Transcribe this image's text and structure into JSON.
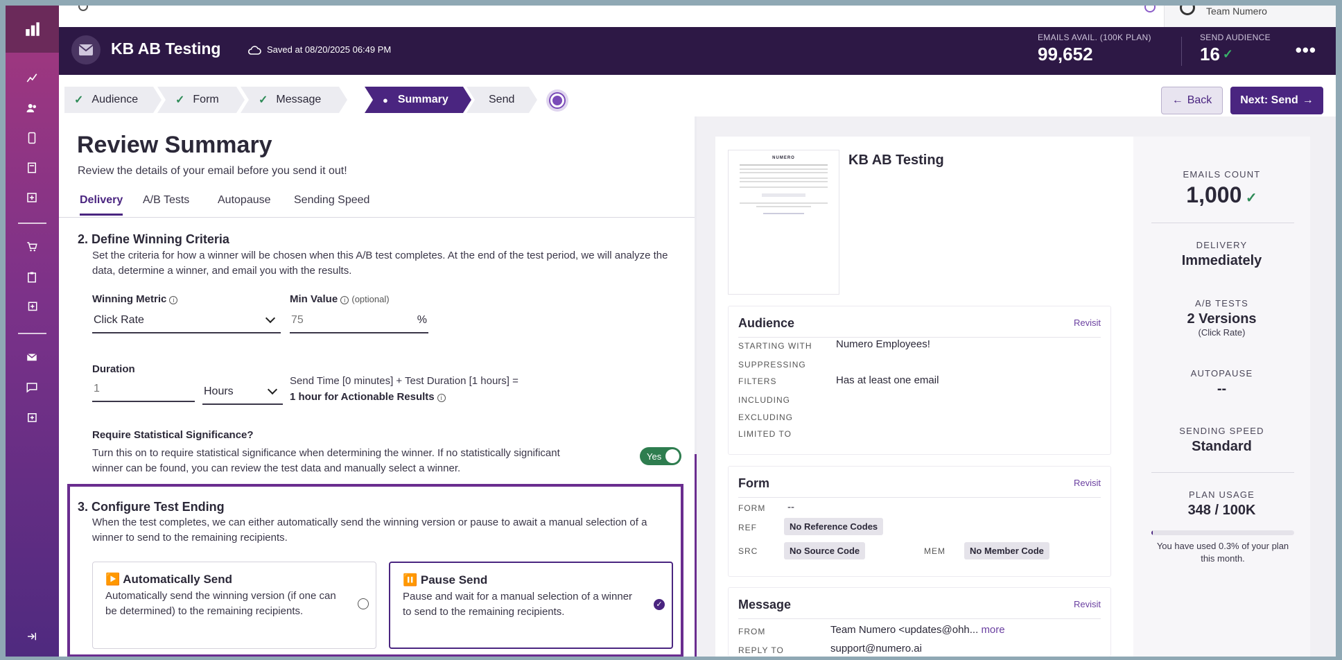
{
  "topbar": {
    "team_name": "Team Numero"
  },
  "header": {
    "title": "KB AB Testing",
    "saved_text": "Saved at 08/20/2025 06:49 PM",
    "emails_avail_label": "EMAILS AVAIL. (100K PLAN)",
    "emails_avail_value": "99,652",
    "send_audience_label": "SEND AUDIENCE",
    "send_audience_value": "16",
    "more_label": "•••"
  },
  "steps": [
    {
      "label": "Audience",
      "done": true
    },
    {
      "label": "Form",
      "done": true
    },
    {
      "label": "Message",
      "done": true
    },
    {
      "label": "Summary",
      "active": true
    },
    {
      "label": "Send"
    }
  ],
  "nav": {
    "back_label": "Back",
    "next_label": "Next: Send"
  },
  "review": {
    "title": "Review Summary",
    "subtitle": "Review the details of your email before you send it out!",
    "tabs": [
      "Delivery",
      "A/B Tests",
      "Autopause",
      "Sending Speed"
    ],
    "criteria": {
      "heading": "2. Define Winning Criteria",
      "description": "Set the criteria for how a winner will be chosen when this A/B test completes. At the end of the test period, we will analyze the data, determine a winner, and email you with the results.",
      "metric_label": "Winning Metric",
      "metric_value": "Click Rate",
      "min_label": "Min Value",
      "min_optional": "(optional)",
      "min_value": "75",
      "min_unit": "%",
      "duration_label": "Duration",
      "duration_value": "1",
      "duration_unit": "Hours",
      "calc_line1": "Send Time [0 minutes] + Test Duration [1 hours] =",
      "calc_line2": "1 hour for Actionable Results",
      "sig_label": "Require Statistical Significance?",
      "sig_description": "Turn this on to require statistical significance when determining the winner. If no statistically significant winner can be found, you can review the test data and manually select a winner.",
      "sig_toggle": "Yes"
    },
    "ending": {
      "heading": "3. Configure Test Ending",
      "description": "When the test completes, we can either automatically send the winning version or pause to await a manual selection of a winner to send to the remaining recipients.",
      "auto_title": "▶️ Automatically Send",
      "auto_desc": "Automatically send the winning version (if one can be determined) to the remaining recipients.",
      "pause_title": "⏸️ Pause Send",
      "pause_desc": "Pause and wait for a manual selection of a winner to send to the remaining recipients.",
      "selected": "pause"
    }
  },
  "preview": {
    "title": "KB AB Testing",
    "audience": {
      "heading": "Audience",
      "revisit": "Revisit",
      "starting_with_label": "STARTING WITH",
      "starting_with": "Numero Employees!",
      "suppressing_label": "SUPPRESSING",
      "filters_label": "FILTERS",
      "filters": "Has at least one email",
      "including_label": "INCLUDING",
      "excluding_label": "EXCLUDING",
      "limited_label": "LIMITED TO"
    },
    "form": {
      "heading": "Form",
      "revisit": "Revisit",
      "form_label": "FORM",
      "form_value": "--",
      "ref_label": "REF",
      "ref_value": "No Reference Codes",
      "src_label": "SRC",
      "src_value": "No Source Code",
      "mem_label": "MEM",
      "mem_value": "No Member Code"
    },
    "message": {
      "heading": "Message",
      "revisit": "Revisit",
      "from_label": "FROM",
      "from_value": "Team Numero <updates@ohh...",
      "more": "more",
      "reply_label": "REPLY TO",
      "reply_value": "support@numero.ai"
    },
    "thumbnail_logo": "NUMERO"
  },
  "summary": {
    "emails_count_label": "EMAILS COUNT",
    "emails_count": "1,000",
    "delivery_label": "DELIVERY",
    "delivery": "Immediately",
    "ab_label": "A/B TESTS",
    "ab_value": "2 Versions",
    "ab_sub": "(Click Rate)",
    "autopause_label": "AUTOPAUSE",
    "autopause": "--",
    "speed_label": "SENDING SPEED",
    "speed": "Standard",
    "usage_label": "PLAN USAGE",
    "usage": "348 / 100K",
    "usage_fraction": 0.003,
    "usage_note": "You have used 0.3% of your plan this month."
  },
  "colors": {
    "brand": "#4a2580",
    "header": "#2d1845",
    "success": "#2e7d4f",
    "accent_border": "#6a2d8f"
  },
  "icons": [
    "logo-icon",
    "analytics-icon",
    "contacts-icon",
    "mobile-icon",
    "pages-icon",
    "add-box-icon",
    "cart-icon",
    "clipboard-icon",
    "library-add-icon",
    "email-icon",
    "chat-icon",
    "add-content-icon",
    "collapse-icon",
    "cloud-icon",
    "location-pin-icon",
    "check-icon",
    "info-icon",
    "chevron-down-icon"
  ]
}
